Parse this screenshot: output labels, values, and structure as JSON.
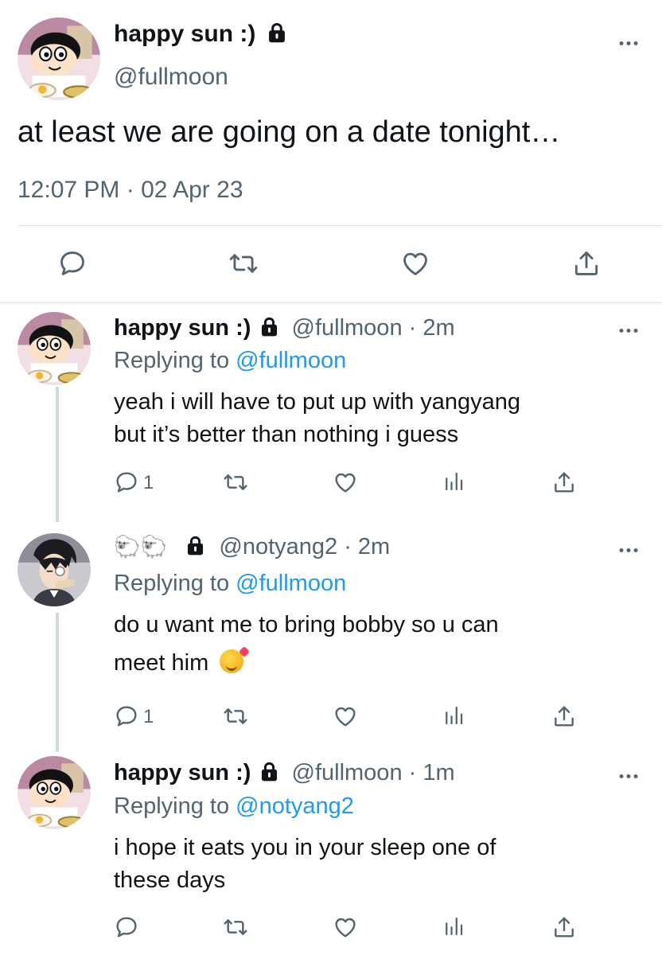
{
  "main_tweet": {
    "display_name": "happy sun :)",
    "handle": "@fullmoon",
    "text": "at least we are going on a date tonight…",
    "timestamp": "12:07 PM · 02 Apr 23"
  },
  "replies": [
    {
      "display_name": "happy sun :)",
      "handle_time": "@fullmoon · 2m",
      "replying_label": "Replying to",
      "replying_to": "@fullmoon",
      "text_lines": [
        "yeah i will have to put up with yangyang",
        "but it’s better than nothing i guess"
      ],
      "reply_count": "1"
    },
    {
      "display_name": "🐑🐑",
      "handle_time": "@notyang2 · 2m",
      "replying_label": "Replying to",
      "replying_to": "@fullmoon",
      "text_lines": [
        "do u want me to bring bobby so u can",
        "meet him"
      ],
      "emoji_name": "smiling-face-with-hearts",
      "reply_count": "1"
    },
    {
      "display_name": "happy sun :)",
      "handle_time": "@fullmoon · 1m",
      "replying_label": "Replying to",
      "replying_to": "@notyang2",
      "text_lines": [
        "i hope it eats you in your sleep one of",
        "these days"
      ],
      "reply_count": ""
    }
  ],
  "icons": {
    "reply": "speech-bubble-icon",
    "retweet": "retweet-arrows-icon",
    "like": "heart-icon",
    "views": "bar-chart-icon",
    "share": "share-arrow-icon",
    "more": "ellipsis-icon",
    "lock": "lock-icon"
  },
  "colors": {
    "text": "#0f1419",
    "secondary": "#536471",
    "link": "#1d9bf0",
    "divider": "#e1e5e8"
  }
}
